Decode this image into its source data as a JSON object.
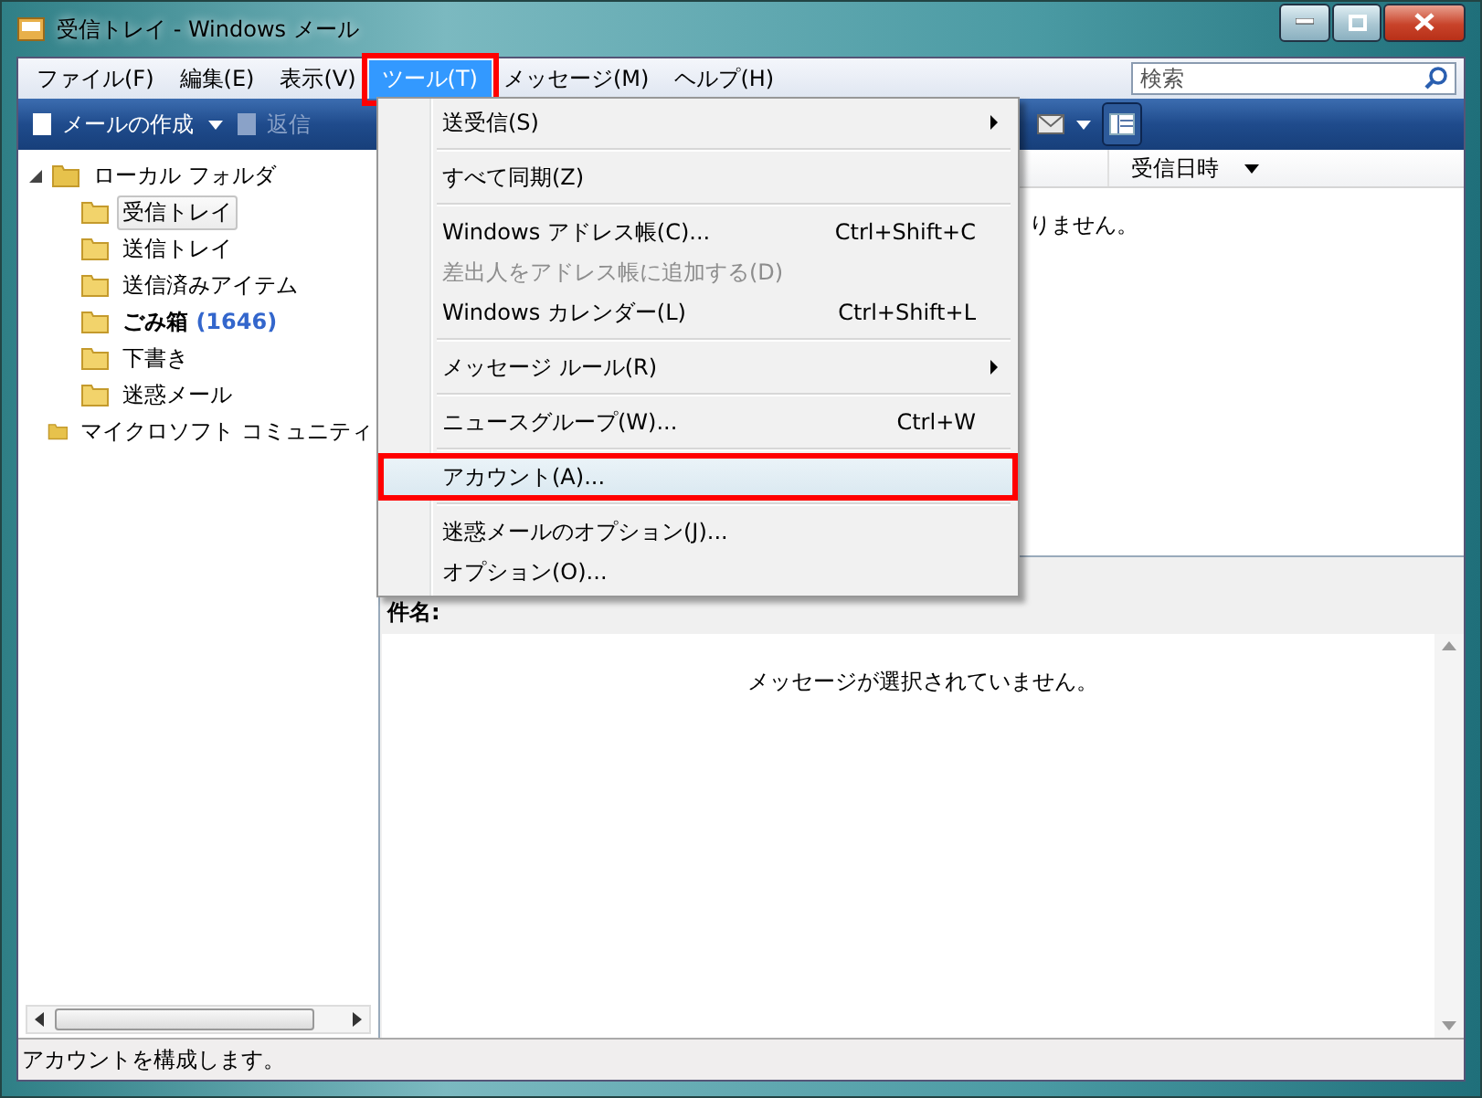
{
  "window": {
    "title": "受信トレイ - Windows メール"
  },
  "menu_bar": [
    {
      "label": "ファイル(F)",
      "selected": false,
      "annotated": false
    },
    {
      "label": "編集(E)",
      "selected": false,
      "annotated": false
    },
    {
      "label": "表示(V)",
      "selected": false,
      "annotated": false
    },
    {
      "label": "ツール(T)",
      "selected": true,
      "annotated": true
    },
    {
      "label": "メッセージ(M)",
      "selected": false,
      "annotated": false
    },
    {
      "label": "ヘルプ(H)",
      "selected": false,
      "annotated": false
    }
  ],
  "search": {
    "placeholder": "検索"
  },
  "toolbar": [
    {
      "label": "メールの作成",
      "disabled": false,
      "dropdown": true
    },
    {
      "label": "返信",
      "disabled": true,
      "dropdown": false
    }
  ],
  "folders": [
    {
      "label": "ローカル フォルダ",
      "expanded": true,
      "children": [
        {
          "label": "受信トレイ",
          "selected": true
        },
        {
          "label": "送信トレイ",
          "selected": false
        },
        {
          "label": "送信済みアイテム",
          "selected": false
        },
        {
          "label": "ごみ箱",
          "selected": false,
          "count": "(1646)"
        },
        {
          "label": "下書き",
          "selected": false
        },
        {
          "label": "迷惑メール",
          "selected": false
        }
      ]
    },
    {
      "label": "マイクロソフト コミュニティ"
    }
  ],
  "message_list": {
    "columns": [
      "受信日時"
    ],
    "empty_text": "りません。"
  },
  "preview": {
    "subject_label": "件名:",
    "body": "メッセージが選択されていません。"
  },
  "status_bar": "アカウントを構成します。",
  "tools_menu": [
    {
      "kind": "item",
      "label": "送受信(S)",
      "disabled": false,
      "submenu": true,
      "hovered": false,
      "annotated": false
    },
    {
      "kind": "separator"
    },
    {
      "kind": "item",
      "label": "すべて同期(Z)",
      "disabled": false,
      "submenu": false,
      "hovered": false,
      "annotated": false
    },
    {
      "kind": "separator"
    },
    {
      "kind": "item",
      "label": "Windows アドレス帳(C)...",
      "shortcut": "Ctrl+Shift+C",
      "disabled": false,
      "submenu": false,
      "hovered": false,
      "annotated": false
    },
    {
      "kind": "item",
      "label": "差出人をアドレス帳に追加する(D)",
      "disabled": true,
      "submenu": false,
      "hovered": false,
      "annotated": false
    },
    {
      "kind": "item",
      "label": "Windows カレンダー(L)",
      "shortcut": "Ctrl+Shift+L",
      "disabled": false,
      "submenu": false,
      "hovered": false,
      "annotated": false
    },
    {
      "kind": "separator"
    },
    {
      "kind": "item",
      "label": "メッセージ ルール(R)",
      "disabled": false,
      "submenu": true,
      "hovered": false,
      "annotated": false
    },
    {
      "kind": "separator"
    },
    {
      "kind": "item",
      "label": "ニュースグループ(W)...",
      "shortcut": "Ctrl+W",
      "disabled": false,
      "submenu": false,
      "hovered": false,
      "annotated": false
    },
    {
      "kind": "separator"
    },
    {
      "kind": "item",
      "label": "アカウント(A)...",
      "disabled": false,
      "submenu": false,
      "hovered": true,
      "annotated": true
    },
    {
      "kind": "separator"
    },
    {
      "kind": "item",
      "label": "迷惑メールのオプション(J)...",
      "disabled": false,
      "submenu": false,
      "hovered": false,
      "annotated": false
    },
    {
      "kind": "item",
      "label": "オプション(O)...",
      "disabled": false,
      "submenu": false,
      "hovered": false,
      "annotated": false
    }
  ]
}
